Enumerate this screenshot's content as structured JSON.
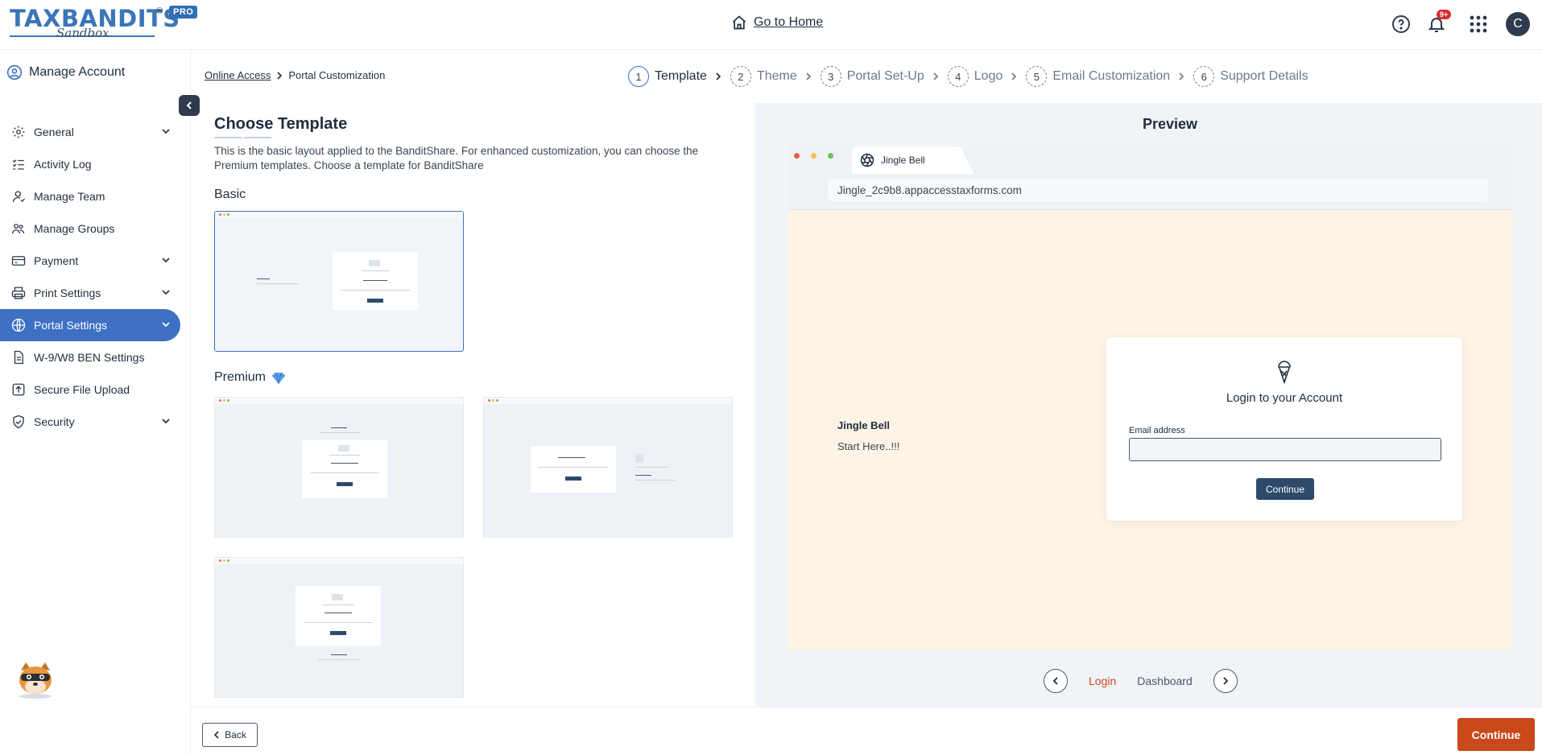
{
  "header": {
    "logo_text": "TAXBANDITS",
    "logo_sub": "Sandbox",
    "pro_badge": "PRO",
    "registered": "®",
    "home_link": "Go to Home",
    "notification_count": "9+",
    "avatar_initial": "C"
  },
  "sidebar": {
    "manage_account": "Manage Account",
    "items": [
      {
        "label": "General",
        "icon": "gear-icon",
        "expandable": true
      },
      {
        "label": "Activity Log",
        "icon": "list-check-icon",
        "expandable": false
      },
      {
        "label": "Manage Team",
        "icon": "user-icon",
        "expandable": false
      },
      {
        "label": "Manage Groups",
        "icon": "users-icon",
        "expandable": false
      },
      {
        "label": "Payment",
        "icon": "card-icon",
        "expandable": true
      },
      {
        "label": "Print Settings",
        "icon": "printer-icon",
        "expandable": true
      },
      {
        "label": "Portal Settings",
        "icon": "globe-icon",
        "expandable": true,
        "active": true
      },
      {
        "label": "W-9/W8 BEN Settings",
        "icon": "document-icon",
        "expandable": false
      },
      {
        "label": "Secure File Upload",
        "icon": "upload-icon",
        "expandable": false
      },
      {
        "label": "Security",
        "icon": "shield-icon",
        "expandable": true
      }
    ]
  },
  "breadcrumb": {
    "parent": "Online Access",
    "current": "Portal Customization"
  },
  "steps": [
    {
      "num": "1",
      "label": "Template",
      "active": true
    },
    {
      "num": "2",
      "label": "Theme"
    },
    {
      "num": "3",
      "label": "Portal Set-Up"
    },
    {
      "num": "4",
      "label": "Logo"
    },
    {
      "num": "5",
      "label": "Email Customization"
    },
    {
      "num": "6",
      "label": "Support Details"
    }
  ],
  "content": {
    "title": "Choose Template",
    "description": "This is the basic layout applied to the BanditShare. For enhanced customization, you can choose the Premium templates. Choose a template for BanditShare",
    "basic_label": "Basic",
    "premium_label": "Premium"
  },
  "preview": {
    "title": "Preview",
    "tab_title": "Jingle Bell",
    "url": "Jingle_2c9b8.appaccesstaxforms.com",
    "brand_name": "Jingle Bell",
    "brand_tagline": "Start Here..!!!",
    "login_title": "Login to your Account",
    "email_label": "Email address",
    "email_value": "",
    "login_button": "Continue",
    "pages": [
      "Login",
      "Dashboard"
    ],
    "active_page": "Login"
  },
  "footer": {
    "back_label": "Back",
    "continue_label": "Continue"
  },
  "colors": {
    "accent": "#3e70c4",
    "primary_action": "#c9491b",
    "dark_button": "#2e4a6b",
    "preview_bg": "#fdf4e6"
  }
}
